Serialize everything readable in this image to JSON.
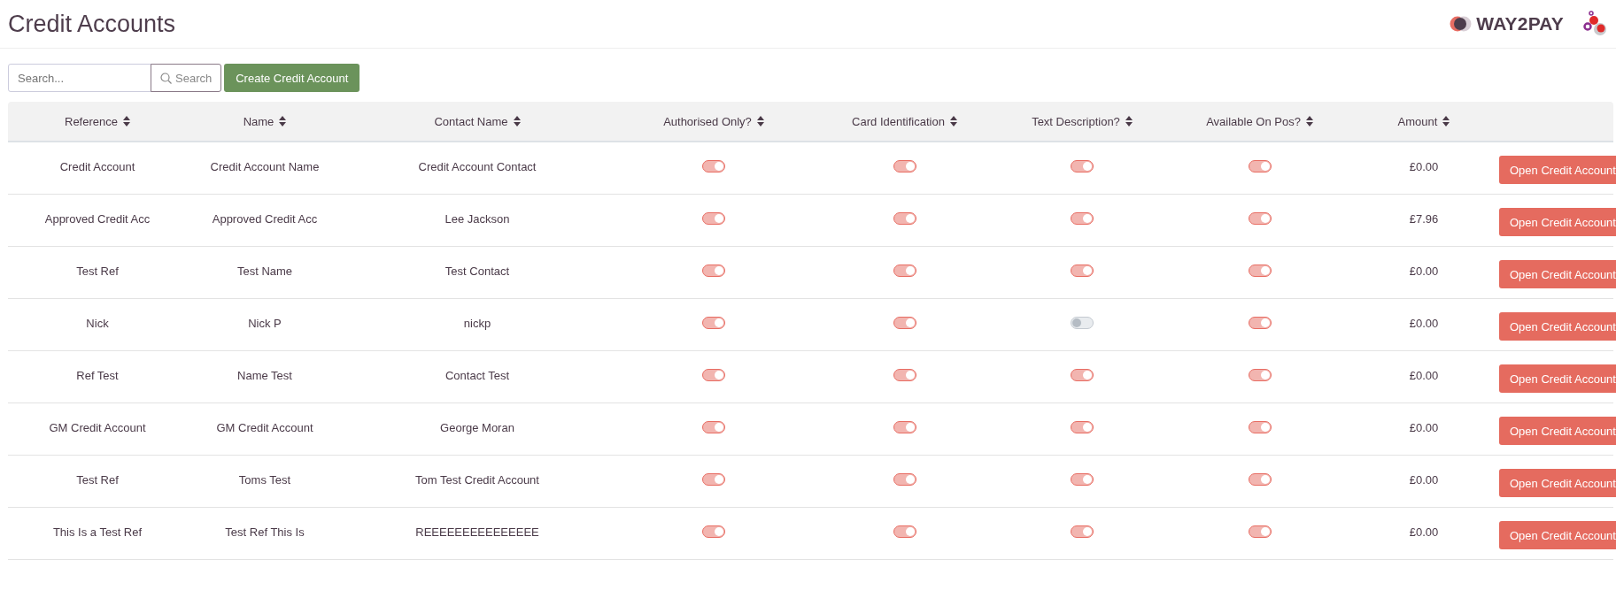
{
  "page_title": "Credit Accounts",
  "brand": {
    "wordmark": "WAY2PAY"
  },
  "toolbar": {
    "search_placeholder": "Search...",
    "search_button": "Search",
    "create_button": "Create Credit Account"
  },
  "table": {
    "columns": [
      "Reference",
      "Name",
      "Contact Name",
      "Authorised Only?",
      "Card Identification",
      "Text Description?",
      "Available On Pos?",
      "Amount"
    ],
    "rows": [
      {
        "reference": "Credit Account",
        "name": "Credit Account Name",
        "contact": "Credit Account Contact",
        "authorised_only": true,
        "card_identification": true,
        "text_description": true,
        "available_on_pos": true,
        "amount": "£0.00",
        "action": "Open Credit Account"
      },
      {
        "reference": "Approved Credit Acc",
        "name": "Approved Credit Acc",
        "contact": "Lee Jackson",
        "authorised_only": true,
        "card_identification": true,
        "text_description": true,
        "available_on_pos": true,
        "amount": "£7.96",
        "action": "Open Credit Account"
      },
      {
        "reference": "Test Ref",
        "name": "Test Name",
        "contact": "Test Contact",
        "authorised_only": true,
        "card_identification": true,
        "text_description": true,
        "available_on_pos": true,
        "amount": "£0.00",
        "action": "Open Credit Account"
      },
      {
        "reference": "Nick",
        "name": "Nick P",
        "contact": "nickp",
        "authorised_only": true,
        "card_identification": true,
        "text_description": false,
        "available_on_pos": true,
        "amount": "£0.00",
        "action": "Open Credit Account"
      },
      {
        "reference": "Ref Test",
        "name": "Name Test",
        "contact": "Contact Test",
        "authorised_only": true,
        "card_identification": true,
        "text_description": true,
        "available_on_pos": true,
        "amount": "£0.00",
        "action": "Open Credit Account"
      },
      {
        "reference": "GM Credit Account",
        "name": "GM Credit Account",
        "contact": "George Moran",
        "authorised_only": true,
        "card_identification": true,
        "text_description": true,
        "available_on_pos": true,
        "amount": "£0.00",
        "action": "Open Credit Account"
      },
      {
        "reference": "Test Ref",
        "name": "Toms Test",
        "contact": "Tom Test Credit Account",
        "authorised_only": true,
        "card_identification": true,
        "text_description": true,
        "available_on_pos": true,
        "amount": "£0.00",
        "action": "Open Credit Account"
      },
      {
        "reference": "This Is a Test Ref",
        "name": "Test Ref This Is",
        "contact": "REEEEEEEEEEEEEEE",
        "authorised_only": true,
        "card_identification": true,
        "text_description": true,
        "available_on_pos": true,
        "amount": "£0.00",
        "action": "Open Credit Account"
      }
    ]
  }
}
